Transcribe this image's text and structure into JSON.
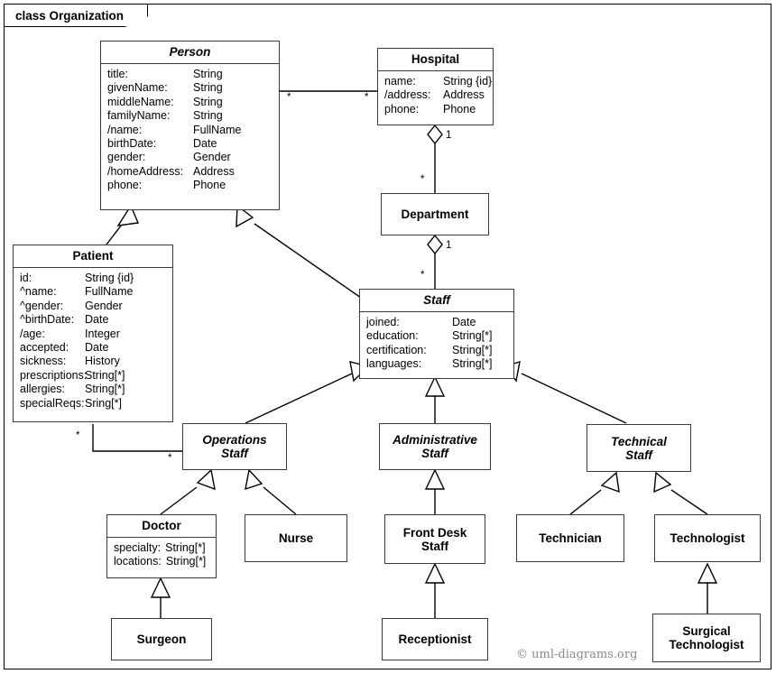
{
  "frame": {
    "label": "class Organization"
  },
  "watermark": "© uml-diagrams.org",
  "classes": {
    "person": {
      "name": "Person",
      "abstract": true,
      "attrs": [
        {
          "name": "title:",
          "type": "String"
        },
        {
          "name": "givenName:",
          "type": "String"
        },
        {
          "name": "middleName:",
          "type": "String"
        },
        {
          "name": "familyName:",
          "type": "String"
        },
        {
          "name": "/name:",
          "type": "FullName"
        },
        {
          "name": "birthDate:",
          "type": "Date"
        },
        {
          "name": "gender:",
          "type": "Gender"
        },
        {
          "name": "/homeAddress:",
          "type": "Address"
        },
        {
          "name": "phone:",
          "type": "Phone"
        }
      ]
    },
    "hospital": {
      "name": "Hospital",
      "abstract": false,
      "attrs": [
        {
          "name": "name:",
          "type": "String {id}"
        },
        {
          "name": "/address:",
          "type": "Address"
        },
        {
          "name": "phone:",
          "type": "Phone"
        }
      ]
    },
    "patient": {
      "name": "Patient",
      "abstract": false,
      "attrs": [
        {
          "name": "id:",
          "type": "String {id}"
        },
        {
          "name": "^name:",
          "type": "FullName"
        },
        {
          "name": "^gender:",
          "type": "Gender"
        },
        {
          "name": "^birthDate:",
          "type": "Date"
        },
        {
          "name": "/age:",
          "type": "Integer"
        },
        {
          "name": "accepted:",
          "type": "Date"
        },
        {
          "name": "sickness:",
          "type": "History"
        },
        {
          "name": "prescriptions:",
          "type": "String[*]"
        },
        {
          "name": "allergies:",
          "type": "String[*]"
        },
        {
          "name": "specialReqs:",
          "type": "Sring[*]"
        }
      ]
    },
    "department": {
      "name": "Department",
      "abstract": false,
      "attrs": []
    },
    "staff": {
      "name": "Staff",
      "abstract": true,
      "attrs": [
        {
          "name": "joined:",
          "type": "Date"
        },
        {
          "name": "education:",
          "type": "String[*]"
        },
        {
          "name": "certification:",
          "type": "String[*]"
        },
        {
          "name": "languages:",
          "type": "String[*]"
        }
      ]
    },
    "operations_staff": {
      "name": "Operations\nStaff",
      "abstract": true,
      "attrs": []
    },
    "administrative_staff": {
      "name": "Administrative\nStaff",
      "abstract": true,
      "attrs": []
    },
    "technical_staff": {
      "name": "Technical\nStaff",
      "abstract": true,
      "attrs": []
    },
    "doctor": {
      "name": "Doctor",
      "abstract": false,
      "attrs": [
        {
          "name": "specialty:",
          "type": "String[*]"
        },
        {
          "name": "locations:",
          "type": "String[*]"
        }
      ]
    },
    "nurse": {
      "name": "Nurse",
      "abstract": false,
      "attrs": []
    },
    "front_desk_staff": {
      "name": "Front Desk\nStaff",
      "abstract": false,
      "attrs": []
    },
    "technician": {
      "name": "Technician",
      "abstract": false,
      "attrs": []
    },
    "technologist": {
      "name": "Technologist",
      "abstract": false,
      "attrs": []
    },
    "surgeon": {
      "name": "Surgeon",
      "abstract": false,
      "attrs": []
    },
    "receptionist": {
      "name": "Receptionist",
      "abstract": false,
      "attrs": []
    },
    "surgical_technologist": {
      "name": "Surgical\nTechnologist",
      "abstract": false,
      "attrs": []
    }
  },
  "multiplicities": {
    "person_hospital_source": "*",
    "person_hospital_target": "*",
    "hospital_department_whole": "1",
    "hospital_department_part": "*",
    "department_staff_whole": "1",
    "department_staff_part": "*",
    "patient_operations_source": "*",
    "patient_operations_target": "*"
  }
}
